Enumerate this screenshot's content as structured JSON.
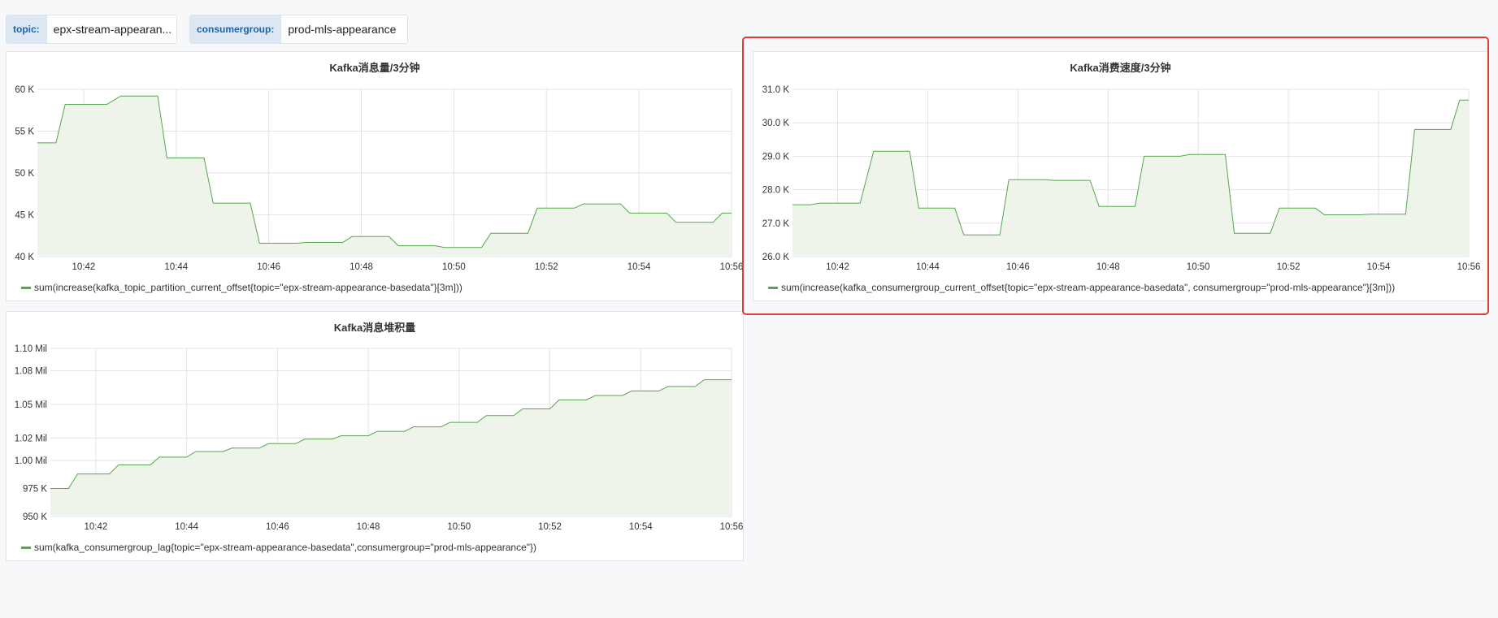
{
  "variables": [
    {
      "label": "topic:",
      "value": "epx-stream-appearan..."
    },
    {
      "label": "consumergroup:",
      "value": "prod-mls-appearance"
    }
  ],
  "colors": {
    "series": "#56a64b",
    "fill": "#eef4ea",
    "grid": "#e3e3e3",
    "highlight": "#e53935"
  },
  "panels": [
    {
      "title": "Kafka消息量/3分钟",
      "legend": "sum(increase(kafka_topic_partition_current_offset{topic=\"epx-stream-appearance-basedata\"}[3m]))"
    },
    {
      "title": "Kafka消费速度/3分钟",
      "legend": "sum(increase(kafka_consumergroup_current_offset{topic=\"epx-stream-appearance-basedata\", consumergroup=\"prod-mls-appearance\"}[3m]))"
    },
    {
      "title": "Kafka消息堆积量",
      "legend": "sum(kafka_consumergroup_lag{topic=\"epx-stream-appearance-basedata\",consumergroup=\"prod-mls-appearance\"})"
    }
  ],
  "chart_data": [
    {
      "type": "area",
      "title": "Kafka消息量/3分钟",
      "xlabel": "",
      "ylabel": "",
      "x_ticks": [
        "10:42",
        "10:44",
        "10:46",
        "10:48",
        "10:50",
        "10:52",
        "10:54",
        "10:56"
      ],
      "y_ticks": [
        "40 K",
        "45 K",
        "50 K",
        "55 K",
        "60 K"
      ],
      "xlim": [
        "10:41:00",
        "10:56:00"
      ],
      "ylim": [
        40000,
        60000
      ],
      "grid": true,
      "series": [
        {
          "name": "sum(increase(kafka_topic_partition_current_offset{topic=\"epx-stream-appearance-basedata\"}[3m]))",
          "x": [
            "10:41:00",
            "10:41:24",
            "10:41:36",
            "10:42:30",
            "10:42:48",
            "10:43:36",
            "10:43:48",
            "10:44:36",
            "10:44:48",
            "10:45:36",
            "10:45:48",
            "10:46:36",
            "10:46:48",
            "10:47:36",
            "10:47:48",
            "10:48:36",
            "10:48:48",
            "10:49:36",
            "10:49:48",
            "10:50:36",
            "10:50:48",
            "10:51:36",
            "10:51:48",
            "10:52:36",
            "10:52:48",
            "10:53:36",
            "10:53:48",
            "10:54:36",
            "10:54:48",
            "10:55:36",
            "10:55:48",
            "10:56:00"
          ],
          "values": [
            53600,
            53600,
            58200,
            58200,
            59200,
            59200,
            51800,
            51800,
            46400,
            46400,
            41600,
            41600,
            41700,
            41700,
            42400,
            42400,
            41300,
            41300,
            41100,
            41100,
            42800,
            42800,
            45800,
            45800,
            46300,
            46300,
            45200,
            45200,
            44100,
            44100,
            45200,
            45200
          ]
        }
      ]
    },
    {
      "type": "area",
      "title": "Kafka消费速度/3分钟",
      "xlabel": "",
      "ylabel": "",
      "x_ticks": [
        "10:42",
        "10:44",
        "10:46",
        "10:48",
        "10:50",
        "10:52",
        "10:54",
        "10:56"
      ],
      "y_ticks": [
        "26.0 K",
        "27.0 K",
        "28.0 K",
        "29.0 K",
        "30.0 K",
        "31.0 K"
      ],
      "xlim": [
        "10:41:00",
        "10:56:00"
      ],
      "ylim": [
        26000,
        31000
      ],
      "grid": true,
      "series": [
        {
          "name": "sum(increase(kafka_consumergroup_current_offset{topic=\"epx-stream-appearance-basedata\", consumergroup=\"prod-mls-appearance\"}[3m]))",
          "x": [
            "10:41:00",
            "10:41:24",
            "10:41:36",
            "10:42:30",
            "10:42:48",
            "10:43:36",
            "10:43:48",
            "10:44:36",
            "10:44:48",
            "10:45:36",
            "10:45:48",
            "10:46:36",
            "10:46:48",
            "10:47:36",
            "10:47:48",
            "10:48:36",
            "10:48:48",
            "10:49:36",
            "10:49:48",
            "10:50:36",
            "10:50:48",
            "10:51:36",
            "10:51:48",
            "10:52:36",
            "10:52:48",
            "10:53:36",
            "10:53:48",
            "10:54:36",
            "10:54:48",
            "10:55:36",
            "10:55:48",
            "10:56:00"
          ],
          "values": [
            27550,
            27550,
            27600,
            27600,
            29150,
            29150,
            27450,
            27450,
            26650,
            26650,
            28300,
            28300,
            28280,
            28280,
            27500,
            27500,
            29000,
            29000,
            29050,
            29050,
            26700,
            26700,
            27450,
            27450,
            27250,
            27250,
            27270,
            27270,
            29800,
            29800,
            30680,
            30680
          ]
        }
      ]
    },
    {
      "type": "area",
      "title": "Kafka消息堆积量",
      "xlabel": "",
      "ylabel": "",
      "x_ticks": [
        "10:42",
        "10:44",
        "10:46",
        "10:48",
        "10:50",
        "10:52",
        "10:54",
        "10:56"
      ],
      "y_ticks": [
        "950 K",
        "975 K",
        "1.00 Mil",
        "1.02 Mil",
        "1.05 Mil",
        "1.08 Mil",
        "1.10 Mil"
      ],
      "xlim": [
        "10:41:00",
        "10:56:00"
      ],
      "ylim": [
        950000,
        1100000
      ],
      "grid": true,
      "series": [
        {
          "name": "sum(kafka_consumergroup_lag{topic=\"epx-stream-appearance-basedata\",consumergroup=\"prod-mls-appearance\"})",
          "x": [
            "10:41:00",
            "10:41:24",
            "10:41:36",
            "10:42:18",
            "10:42:30",
            "10:43:12",
            "10:43:24",
            "10:44:00",
            "10:44:12",
            "10:44:48",
            "10:45:00",
            "10:45:36",
            "10:45:48",
            "10:46:24",
            "10:46:36",
            "10:47:12",
            "10:47:24",
            "10:48:00",
            "10:48:12",
            "10:48:48",
            "10:49:00",
            "10:49:36",
            "10:49:48",
            "10:50:24",
            "10:50:36",
            "10:51:12",
            "10:51:24",
            "10:52:00",
            "10:52:12",
            "10:52:48",
            "10:53:00",
            "10:53:36",
            "10:53:48",
            "10:54:24",
            "10:54:36",
            "10:55:12",
            "10:55:24",
            "10:55:48",
            "10:56:00"
          ],
          "values": [
            975000,
            975000,
            988000,
            988000,
            996000,
            996000,
            1003000,
            1003000,
            1008000,
            1008000,
            1011000,
            1011000,
            1015000,
            1015000,
            1019000,
            1019000,
            1022000,
            1022000,
            1026000,
            1026000,
            1030000,
            1030000,
            1034000,
            1034000,
            1040000,
            1040000,
            1046000,
            1046000,
            1054000,
            1054000,
            1058000,
            1058000,
            1062000,
            1062000,
            1066000,
            1066000,
            1072000,
            1072000,
            1072000
          ]
        }
      ]
    }
  ]
}
